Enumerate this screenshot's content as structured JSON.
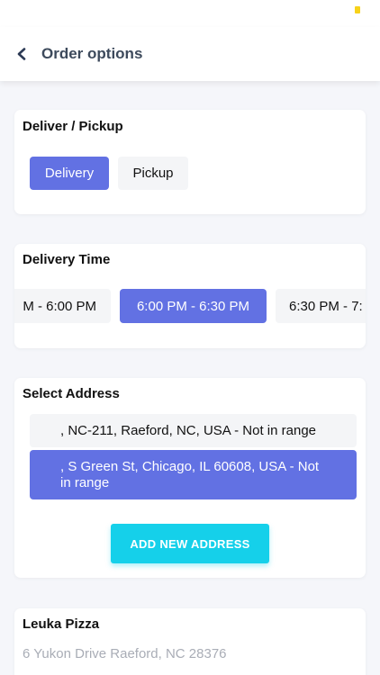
{
  "header": {
    "title": "Order options",
    "back_icon": "chevron-left-icon"
  },
  "deliver_pickup": {
    "title": "Deliver / Pickup",
    "options": [
      {
        "label": "Delivery",
        "selected": true
      },
      {
        "label": "Pickup",
        "selected": false
      }
    ]
  },
  "delivery_time": {
    "title": "Delivery Time",
    "slots": [
      {
        "label": "M - 6:00 PM",
        "selected": false
      },
      {
        "label": "6:00 PM - 6:30 PM",
        "selected": true
      },
      {
        "label": "6:30 PM - 7:",
        "selected": false
      }
    ]
  },
  "select_address": {
    "title": "Select Address",
    "addresses": [
      {
        "label": ", NC-211, Raeford, NC, USA - Not in range",
        "selected": false
      },
      {
        "label": ", S Green St, Chicago, IL 60608, USA - Not in range",
        "selected": true
      }
    ],
    "add_button": "ADD NEW ADDRESS"
  },
  "store": {
    "name": "Leuka Pizza",
    "address": "6 Yukon Drive Raeford, NC 28376"
  },
  "colors": {
    "accent": "#6271e3",
    "add_button": "#15d0ea",
    "background": "#f5f6fa",
    "header_text": "#3d4a5c",
    "muted_text": "#a9adb6",
    "battery": "#f7d21a"
  }
}
